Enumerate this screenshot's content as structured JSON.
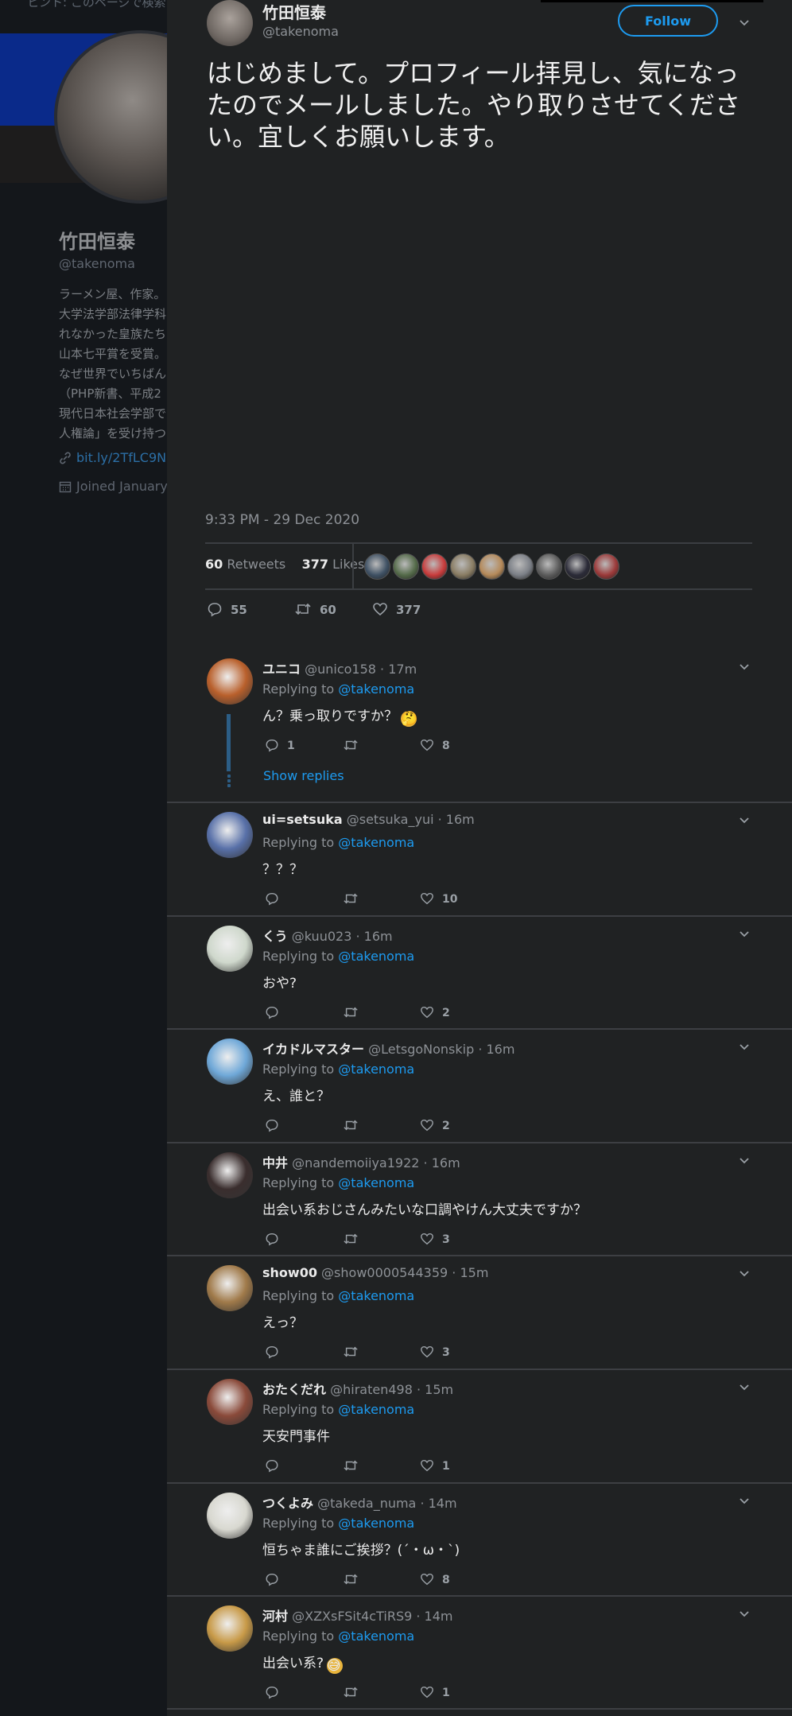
{
  "background": {
    "search_text": "ヒント: このページで検索",
    "profile_name": "竹田恒泰",
    "profile_handle": "@takenoma",
    "bio_lines": [
      "ラーメン屋、作家。",
      "大学法学部法律学科",
      "れなかった皇族たち",
      "山本七平賞を受賞。",
      "なぜ世界でいちばん",
      "（PHP新書、平成2",
      "現代日本社会学部で",
      "人権論」を受け持つ"
    ],
    "link": "bit.ly/2TfLC9N",
    "joined": "Joined January"
  },
  "tweet": {
    "author_name": "竹田恒泰",
    "author_handle": "@takenoma",
    "follow_label": "Follow",
    "text": "はじめまして。プロフィール拝見し、気になったのでメールしました。やり取りさせてください。宜しくお願いします。",
    "timestamp": "9:33 PM - 29 Dec 2020",
    "retweets_count": "60",
    "retweets_label": "Retweets",
    "likes_count": "377",
    "likes_label": "Likes",
    "reply_count": "55",
    "retweet_count": "60",
    "like_count": "377",
    "liker_colors": [
      "#3f5164",
      "#556b4a",
      "#c83c3c",
      "#8a7d64",
      "#b58a5a",
      "#7c8087",
      "#5d5d5d",
      "#2b2b38",
      "#9c3a3a"
    ]
  },
  "replying_to_label": "Replying to",
  "replying_to_handle": "@takenoma",
  "show_replies": "Show replies",
  "replies": [
    {
      "name": "ユニコ",
      "meta": "@unico158 · 17m",
      "text": "ん？乗っ取りですか？",
      "emoji": "🤔",
      "replies": "1",
      "retweets": "",
      "likes": "8",
      "avatar": "#b9602c"
    },
    {
      "name": "ui=setsuka",
      "meta": "@setsuka_yui · 16m",
      "text": "？？？",
      "replies": "",
      "retweets": "",
      "likes": "10",
      "avatar": "#5870a8"
    },
    {
      "name": "くう",
      "meta": "@kuu023 · 16m",
      "text": "おや?",
      "replies": "",
      "retweets": "",
      "likes": "2",
      "avatar": "#cfd8cc"
    },
    {
      "name": "イカドルマスター",
      "meta": "@LetsgoNonskip · 16m",
      "text": "え、誰と？",
      "replies": "",
      "retweets": "",
      "likes": "2",
      "avatar": "#6fa8d8"
    },
    {
      "name": "中井",
      "meta": "@nandemoiiya1922 · 16m",
      "text": "出会い系おじさんみたいな口調やけん大丈夫ですか？",
      "replies": "",
      "retweets": "",
      "likes": "3",
      "avatar": "#3a2e2e"
    },
    {
      "name": "show00",
      "meta": "@show0000544359 · 15m",
      "text": "えっ？",
      "replies": "",
      "retweets": "",
      "likes": "3",
      "avatar": "#a07a4a"
    },
    {
      "name": "おたくだれ",
      "meta": "@hiraten498 · 15m",
      "text": "天安門事件",
      "replies": "",
      "retweets": "",
      "likes": "1",
      "avatar": "#8a4a3a"
    },
    {
      "name": "つくよみ",
      "meta": "@takeda_numa · 14m",
      "text": "恒ちゃま誰にご挨拶？(´・ω・`)",
      "replies": "",
      "retweets": "",
      "likes": "8",
      "avatar": "#d8d8d0"
    },
    {
      "name": "河村",
      "meta": "@XZXsFSit4cTiRS9 · 14m",
      "text": "出会い系?",
      "emoji": "😅",
      "replies": "",
      "retweets": "",
      "likes": "1",
      "avatar": "#c89a48"
    }
  ]
}
